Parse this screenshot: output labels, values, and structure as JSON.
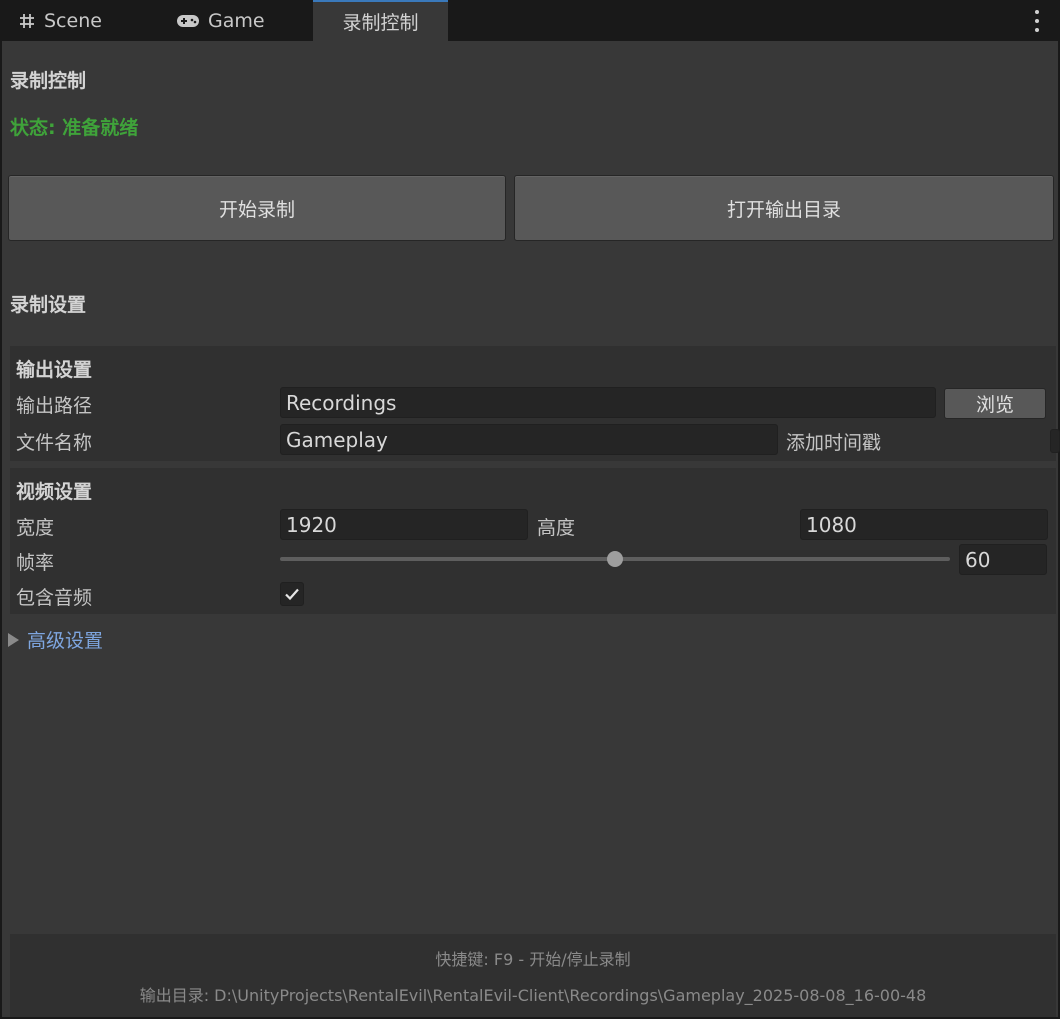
{
  "tabs": [
    {
      "label": "Scene",
      "icon": "grid-icon"
    },
    {
      "label": "Game",
      "icon": "gamepad-icon"
    },
    {
      "label": "录制控制",
      "active": true
    }
  ],
  "header": {
    "title": "录制控制",
    "status": "状态: 准备就绪",
    "status_color": "#3fa33a"
  },
  "buttons": {
    "start": "开始录制",
    "open_dir": "打开输出目录"
  },
  "settings": {
    "title": "录制设置",
    "output": {
      "title": "输出设置",
      "path_label": "输出路径",
      "path_value": "Recordings",
      "browse_label": "浏览",
      "filename_label": "文件名称",
      "filename_value": "Gameplay",
      "timestamp_label": "添加时间戳"
    },
    "video": {
      "title": "视频设置",
      "width_label": "宽度",
      "width_value": "1920",
      "height_label": "高度",
      "height_value": "1080",
      "fps_label": "帧率",
      "fps_value": "60",
      "fps_fraction": 0.5,
      "audio_label": "包含音频",
      "audio_checked": true
    },
    "advanced_label": "高级设置"
  },
  "footer": {
    "hotkey": "快捷键: F9 - 开始/停止录制",
    "output_dir": "输出目录: D:\\UnityProjects\\RentalEvil\\RentalEvil-Client\\Recordings\\Gameplay_2025-08-08_16-00-48"
  },
  "colors": {
    "accent": "#3a79bb",
    "link": "#7ea6e0",
    "panel_bg": "#383838"
  }
}
